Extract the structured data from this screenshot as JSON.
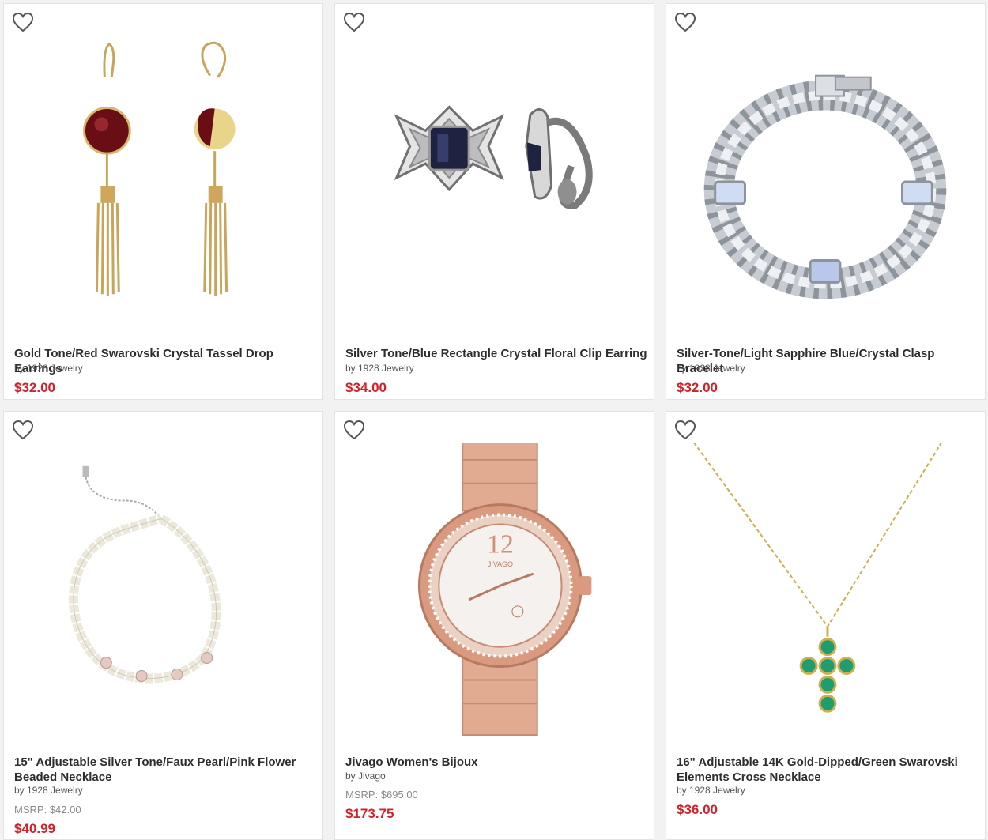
{
  "products": [
    {
      "title_lines": [
        "Gold Tone/Red Swarovski Crystal Tassel Drop Earrings"
      ],
      "brand": "by 1928 Jewelry",
      "msrp": "",
      "price": "$32.00",
      "image": "gold-red-tassel-earrings"
    },
    {
      "title_lines": [
        "Silver Tone/Blue Rectangle Crystal Floral Clip Earring"
      ],
      "brand": "by 1928 Jewelry",
      "msrp": "",
      "price": "$34.00",
      "image": "silver-blue-clip-earring"
    },
    {
      "title_lines": [
        "Silver-Tone/Light Sapphire Blue/Crystal Clasp Bracelet"
      ],
      "brand": "by 1928 Jewelry",
      "msrp": "",
      "price": "$32.00",
      "image": "silver-sapphire-bracelet"
    },
    {
      "title_lines": [
        "15\" Adjustable Silver Tone/Faux Pearl/Pink Flower",
        "Beaded Necklace"
      ],
      "brand": "by 1928 Jewelry",
      "msrp": "MSRP: $42.00",
      "price": "$40.99",
      "image": "pearl-beaded-necklace"
    },
    {
      "title_lines": [
        "Jivago Women's Bijoux"
      ],
      "brand": "by Jivago",
      "msrp": "MSRP: $695.00",
      "price": "$173.75",
      "image": "rose-gold-watch"
    },
    {
      "title_lines": [
        "16\" Adjustable 14K Gold-Dipped/Green Swarovski",
        "Elements Cross Necklace"
      ],
      "brand": "by 1928 Jewelry",
      "msrp": "",
      "price": "$36.00",
      "image": "green-cross-necklace"
    }
  ],
  "watch_dial": {
    "numeral": "12",
    "logo": "JIVAGO"
  },
  "colors": {
    "price": "#d0222b",
    "text": "#2d2d2d",
    "muted": "#8a8a8a",
    "border": "#e3e3e3"
  }
}
